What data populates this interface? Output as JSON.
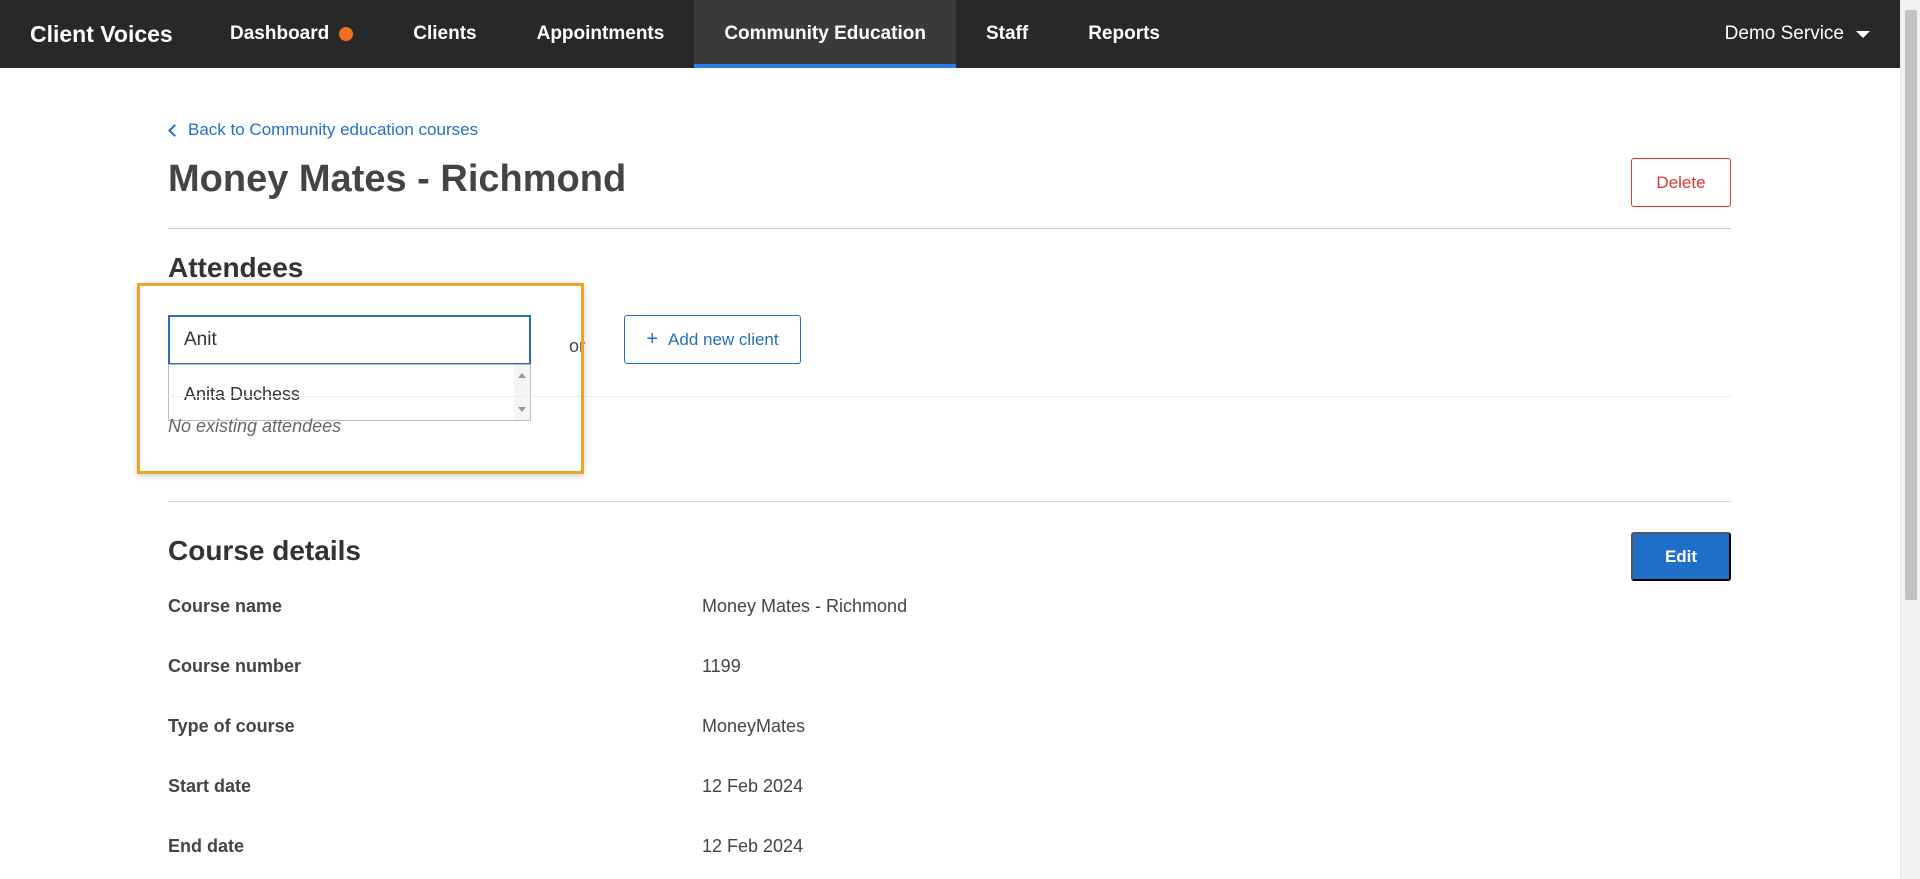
{
  "colors": {
    "nav_bg": "#282828",
    "accent": "#2a7de1",
    "link": "#1f6fc9",
    "danger": "#dd3333",
    "notification_dot": "#f07020",
    "highlight": "#f0a425"
  },
  "nav": {
    "brand": "Client Voices",
    "items": [
      {
        "label": "Dashboard",
        "has_dot": true
      },
      {
        "label": "Clients"
      },
      {
        "label": "Appointments"
      },
      {
        "label": "Community Education",
        "active": true
      },
      {
        "label": "Staff"
      },
      {
        "label": "Reports"
      }
    ],
    "service": "Demo Service"
  },
  "page": {
    "back_link": "Back to Community education courses",
    "title": "Money Mates - Richmond",
    "delete_label": "Delete"
  },
  "attendees": {
    "heading": "Attendees",
    "search_value": "Anit",
    "suggestions": [
      "Anita Duchess"
    ],
    "or_text": "or",
    "add_client_label": "Add new client",
    "empty_text": "No existing attendees"
  },
  "course_details": {
    "heading": "Course details",
    "edit_label": "Edit",
    "fields": [
      {
        "label": "Course name",
        "value": "Money Mates - Richmond"
      },
      {
        "label": "Course number",
        "value": "1199"
      },
      {
        "label": "Type of course",
        "value": "MoneyMates"
      },
      {
        "label": "Start date",
        "value": "12 Feb 2024"
      },
      {
        "label": "End date",
        "value": "12 Feb 2024"
      }
    ]
  }
}
